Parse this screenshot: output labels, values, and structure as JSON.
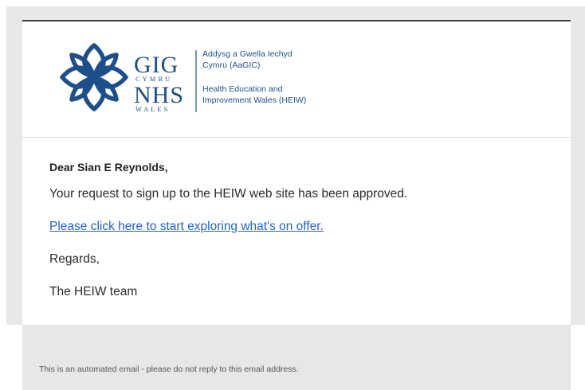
{
  "header": {
    "logo": {
      "name": "GIG CYMRU NHS WALES",
      "org_welsh_line1": "Addysg a Gwella Iechyd",
      "org_welsh_line2": "Cymru (AaGIC)",
      "org_english_line1": "Health Education and",
      "org_english_line2": "Improvement Wales (HEIW)",
      "wordmark_top": "GIG",
      "wordmark_top_sub": "CYMRU",
      "wordmark_bottom": "NHS",
      "wordmark_bottom_sub": "WALES"
    }
  },
  "body": {
    "greeting": "Dear Sian E Reynolds,",
    "message": "Your request to sign up to the HEIW web site has been approved.",
    "link_text": "Please click here to start exploring what's on offer.",
    "regards": "Regards,",
    "signature": "The HEIW team"
  },
  "footer": {
    "note": "This is an automated email - please do not reply to this email address."
  },
  "colors": {
    "accent_link": "#2262c6",
    "logo_blue": "#1f4f8a",
    "frame_gray": "#e8e8e8",
    "card_top_border": "#3b3f44"
  }
}
